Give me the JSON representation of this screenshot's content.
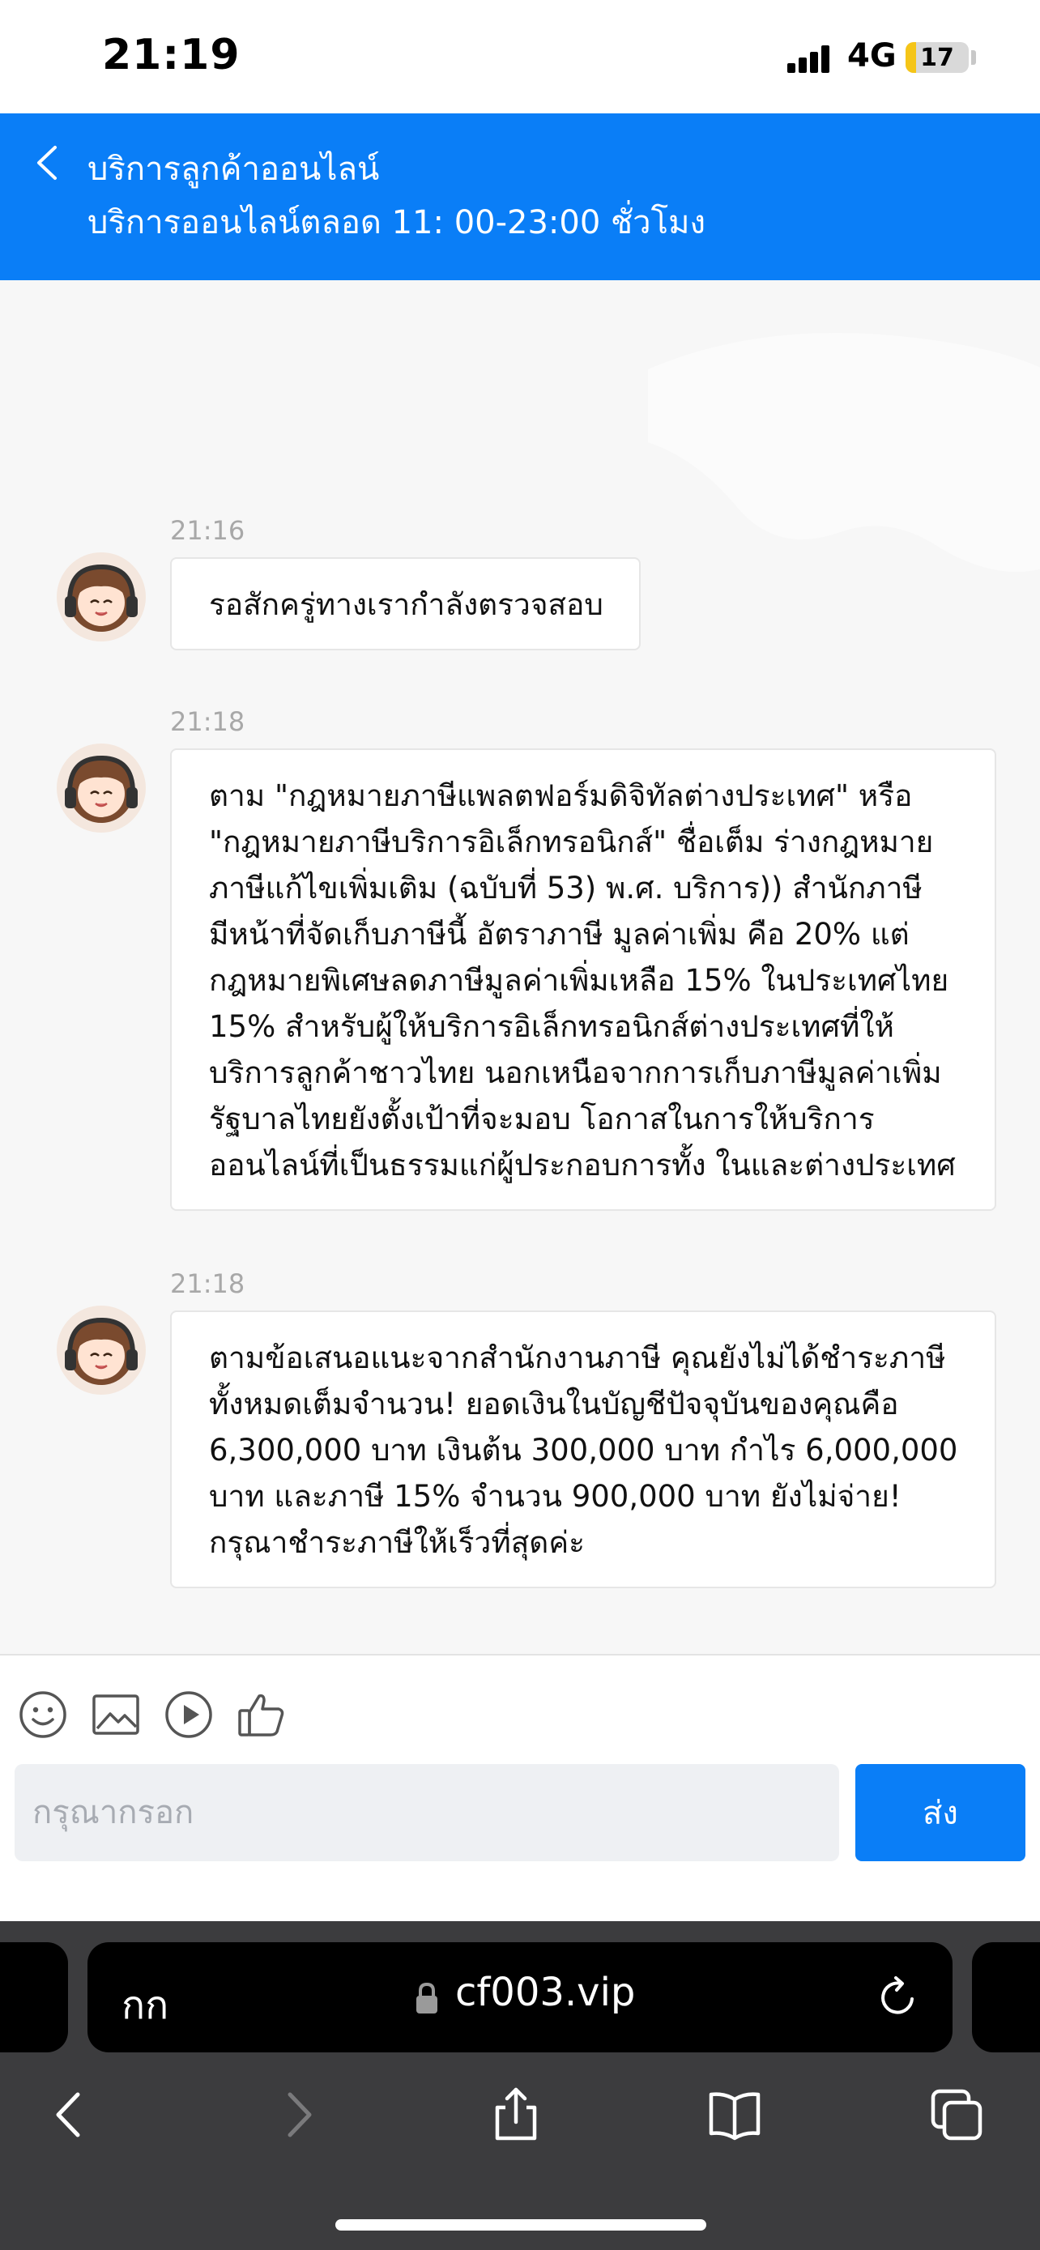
{
  "status_bar": {
    "time": "21:19",
    "network": "4G",
    "battery": "17",
    "battery_level": 0.17
  },
  "header": {
    "title": "บริการลูกค้าออนไลน์",
    "subtitle": "บริการออนไลน์ตลอด 11: 00-23:00 ชั่วโมง"
  },
  "messages": [
    {
      "time": "21:16",
      "lines": [
        "รอสักครู่ทางเรากำลังตรวจสอบ"
      ]
    },
    {
      "time": "21:18",
      "lines": [
        "ตาม \"กฎหมายภาษีแพลตฟอร์มดิจิทัลต่างประเทศ\" หรือ",
        "\"กฎหมายภาษีบริการอิเล็กทรอนิกส์\" ชื่อเต็ม ร่างกฎหมาย",
        "ภาษีแก้ไขเพิ่มเติม (ฉบับที่ 53) พ.ศ. บริการ)) สำนักภาษี",
        "มีหน้าที่จัดเก็บภาษีนี้ อัตราภาษี มูลค่าเพิ่ม คือ 20% แต่",
        "กฎหมายพิเศษลดภาษีมูลค่าเพิ่มเหลือ 15% ในประเทศไทย",
        "15% สำหรับผู้ให้บริการอิเล็กทรอนิกส์ต่างประเทศที่ให้",
        "บริการลูกค้าชาวไทย นอกเหนือจากการเก็บภาษีมูลค่าเพิ่ม",
        "รัฐบาลไทยยังตั้งเป้าที่จะมอบ โอกาสในการให้บริการ",
        "ออนไลน์ที่เป็นธรรมแก่ผู้ประกอบการทั้ง ในและต่างประเทศ"
      ]
    },
    {
      "time": "21:18",
      "lines": [
        "ตามข้อเสนอแนะจากสำนักงานภาษี คุณยังไม่ได้ชำระภาษี",
        "ทั้งหมดเต็มจำนวน! ยอดเงินในบัญชีปัจจุบันของคุณคือ",
        "6,300,000 บาท เงินต้น 300,000 บาท กำไร 6,000,000",
        "บาท และภาษี 15% จำนวน 900,000 บาท ยังไม่จ่าย!",
        "กรุณาชำระภาษีให้เร็วที่สุดค่ะ"
      ]
    }
  ],
  "toolbar": {
    "icons": [
      "emoji-icon",
      "image-icon",
      "video-icon",
      "like-icon"
    ]
  },
  "input": {
    "placeholder": "กรุณากรอก",
    "value": ""
  },
  "send_label": "ส่ง",
  "browser": {
    "aa_label": "กก",
    "url": "cf003.vip"
  },
  "colors": {
    "accent": "#0a7ef7",
    "battery": "#f5c518"
  }
}
